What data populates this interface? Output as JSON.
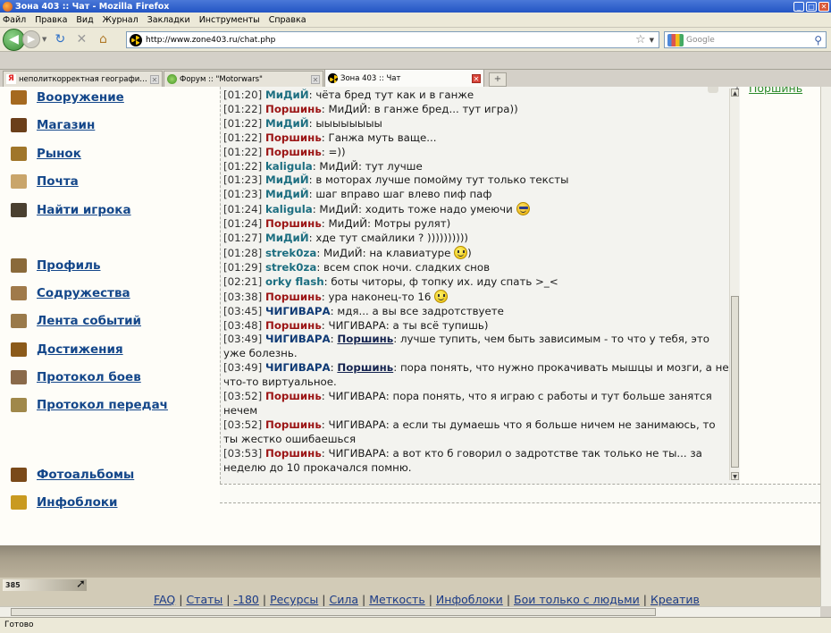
{
  "window": {
    "title": "Зона 403 :: Чат - Mozilla Firefox"
  },
  "menu": [
    "Файл",
    "Правка",
    "Вид",
    "Журнал",
    "Закладки",
    "Инструменты",
    "Справка"
  ],
  "nav": {
    "url": "http://www.zone403.ru/chat.php",
    "search_placeholder": "Google"
  },
  "tabs": [
    {
      "label": "неполиткорректная география — Ян...",
      "icon": "yandex-icon",
      "active": false
    },
    {
      "label": "Форум :: \"Motorwars\"",
      "icon": "forum-icon",
      "active": false
    },
    {
      "label": "Зона 403 :: Чат",
      "icon": "zone403-icon",
      "active": true
    }
  ],
  "sidebar": {
    "items": [
      {
        "label": "Вооружение",
        "icon": "ammo-icon",
        "color": "#a5691f"
      },
      {
        "label": "Магазин",
        "icon": "shop-icon",
        "color": "#6b3f1a"
      },
      {
        "label": "Рынок",
        "icon": "market-icon",
        "color": "#a0762a"
      },
      {
        "label": "Почта",
        "icon": "mail-icon",
        "color": "#c9a56b"
      },
      {
        "label": "Найти игрока",
        "icon": "binoculars-icon",
        "color": "#4a4030"
      },
      {
        "label": "Профиль",
        "icon": "profile-icon",
        "color": "#8a6a3a"
      },
      {
        "label": "Содружества",
        "icon": "alliance-icon",
        "color": "#a07a4a"
      },
      {
        "label": "Лента событий",
        "icon": "events-icon",
        "color": "#9a7a4a"
      },
      {
        "label": "Достижения",
        "icon": "achievements-icon",
        "color": "#8b5a1a"
      },
      {
        "label": "Протокол боев",
        "icon": "battle-log-icon",
        "color": "#8a6a4a"
      },
      {
        "label": "Протокол передач",
        "icon": "transfer-log-icon",
        "color": "#a0884a"
      },
      {
        "label": "Фотоальбомы",
        "icon": "photo-album-icon",
        "color": "#7a4a1a"
      },
      {
        "label": "Инфоблоки",
        "icon": "radiation-icon",
        "color": "#c99a20"
      }
    ]
  },
  "chat": {
    "messages": [
      {
        "time": "[01:20]",
        "nick": "МиДиЙ",
        "color": "blue",
        "text": ": чёта бред тут как и в ганже"
      },
      {
        "time": "[01:22]",
        "nick": "Поршинь",
        "color": "red",
        "text": ": МиДиЙ: в ганже бред... тут игра))"
      },
      {
        "time": "[01:22]",
        "nick": "МиДиЙ",
        "color": "blue",
        "text": ": ыыыыыыыы"
      },
      {
        "time": "[01:22]",
        "nick": "Поршинь",
        "color": "red",
        "text": ": Ганжа муть ваще..."
      },
      {
        "time": "[01:22]",
        "nick": "Поршинь",
        "color": "red",
        "text": ": =))"
      },
      {
        "time": "[01:22]",
        "nick": "kaligula",
        "color": "blue",
        "text": ": МиДиЙ: тут лучше"
      },
      {
        "time": "[01:23]",
        "nick": "МиДиЙ",
        "color": "blue",
        "text": ": в моторах лучше помойму тут только тексты"
      },
      {
        "time": "[01:23]",
        "nick": "МиДиЙ",
        "color": "blue",
        "text": ": шаг вправо шаг влево пиф паф"
      },
      {
        "time": "[01:24]",
        "nick": "kaligula",
        "color": "blue",
        "text": ": МиДиЙ: ходить тоже надо умеючи",
        "smiley": "cool"
      },
      {
        "time": "[01:24]",
        "nick": "Поршинь",
        "color": "red",
        "text": ": МиДиЙ: Мотры рулят)"
      },
      {
        "time": "[01:27]",
        "nick": "МиДиЙ",
        "color": "blue",
        "text": ": хде тут смайлики ? ))))))))))"
      },
      {
        "time": "[01:28]",
        "nick": "strek0za",
        "color": "blue",
        "text": ": МиДиЙ: на клавиатуре",
        "smiley": "smile",
        "after": ")"
      },
      {
        "time": "[01:29]",
        "nick": "strek0za",
        "color": "blue",
        "text": ": всем спок ночи. сладких снов"
      },
      {
        "time": "[02:21]",
        "nick": "orky flash",
        "color": "blue",
        "text": ": боты читоры, ф топку их. иду спать >_<"
      },
      {
        "time": "[03:38]",
        "nick": "Поршинь",
        "color": "red",
        "text": ": ура наконец-то 16",
        "smiley": "smile"
      },
      {
        "time": "[03:45]",
        "nick": "ЧИГИВАРА",
        "color": "navy",
        "text": ": мдя... а вы все задротствуете"
      },
      {
        "time": "[03:48]",
        "nick": "Поршинь",
        "color": "red",
        "text": ": ЧИГИВАРА: а ты всё тупишь)"
      },
      {
        "time": "[03:49]",
        "nick": "ЧИГИВАРА",
        "color": "navy",
        "to": "Поршинь",
        "text": ": лучше тупить, чем быть зависимым - то что у тебя, это уже болезнь."
      },
      {
        "time": "[03:49]",
        "nick": "ЧИГИВАРА",
        "color": "navy",
        "to": "Поршинь",
        "text": ": пора понять, что нужно прокачивать мышцы и мозги, а не что-то виртуальное."
      },
      {
        "time": "[03:52]",
        "nick": "Поршинь",
        "color": "red",
        "text": ": ЧИГИВАРА: пора понять, что я играю с работы и тут больше занятся нечем"
      },
      {
        "time": "[03:52]",
        "nick": "Поршинь",
        "color": "red",
        "text": ": ЧИГИВАРА: а если ты думаешь что я больше ничем не занимаюсь, то ты жестко ошибаешься"
      },
      {
        "time": "[03:53]",
        "nick": "Поршинь",
        "color": "red",
        "text": ": ЧИГИВАРА: а вот кто б говорил о задротстве так только не ты... за неделю до 10 прокачался помню."
      }
    ]
  },
  "online": {
    "count": "1",
    "user": "Поршинь"
  },
  "footer": {
    "counter": "385",
    "links": [
      "FAQ",
      "Статы",
      "-180",
      "Ресурсы",
      "Сила",
      "Меткость",
      "Инфоблоки",
      "Бои только с людьми",
      "Креатив"
    ]
  },
  "status": "Готово"
}
